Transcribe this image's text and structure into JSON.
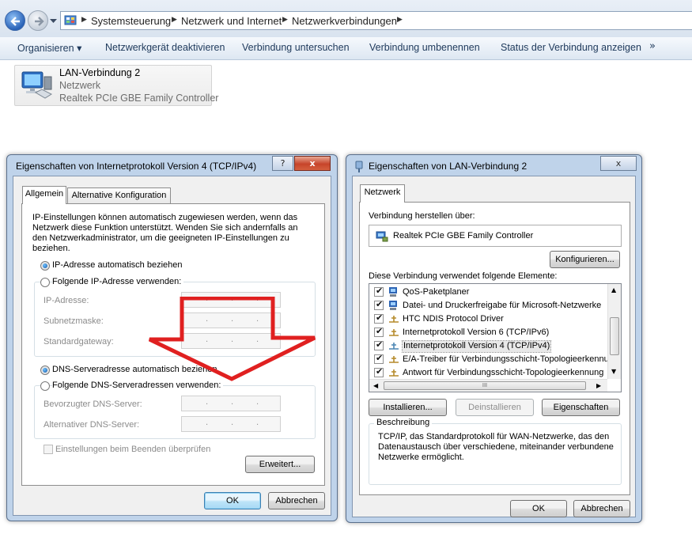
{
  "explorer": {
    "breadcrumb": [
      "Systemsteuerung",
      "Netzwerk und Internet",
      "Netzwerkverbindungen"
    ],
    "commands": {
      "organize": "Organisieren",
      "disable": "Netzwerkgerät deaktivieren",
      "diagnose": "Verbindung untersuchen",
      "rename": "Verbindung umbenennen",
      "status": "Status der Verbindung anzeigen",
      "more": "»"
    },
    "adapter": {
      "name": "LAN-Verbindung 2",
      "network": "Netzwerk",
      "device": "Realtek PCIe GBE Family Controller"
    }
  },
  "ipv4_dialog": {
    "title": "Eigenschaften von Internetprotokoll Version 4 (TCP/IPv4)",
    "help": "?",
    "close": "x",
    "tabs": [
      "Allgemein",
      "Alternative Konfiguration"
    ],
    "description_lines": [
      "IP-Einstellungen können automatisch zugewiesen werden, wenn das",
      "Netzwerk diese Funktion unterstützt. Wenden Sie sich andernfalls an",
      "den Netzwerkadministrator, um die geeigneten IP-Einstellungen zu",
      "beziehen."
    ],
    "ip_auto": "IP-Adresse automatisch beziehen",
    "ip_manual": "Folgende IP-Adresse verwenden:",
    "ip_address": "IP-Adresse:",
    "subnet": "Subnetzmaske:",
    "gateway": "Standardgateway:",
    "dns_auto": "DNS-Serveradresse automatisch beziehen",
    "dns_manual": "Folgende DNS-Serveradressen verwenden:",
    "dns_preferred": "Bevorzugter DNS-Server:",
    "dns_alternate": "Alternativer DNS-Server:",
    "validate": "Einstellungen beim Beenden überprüfen",
    "advanced": "Erweitert...",
    "ok": "OK",
    "cancel": "Abbrechen",
    "ip_auto_selected": true,
    "dns_auto_selected": true
  },
  "lan_dialog": {
    "title": "Eigenschaften von LAN-Verbindung 2",
    "close": "x",
    "tab": "Netzwerk",
    "connect_using": "Verbindung herstellen über:",
    "adapter": "Realtek PCIe GBE Family Controller",
    "configure": "Konfigurieren...",
    "items_label": "Diese Verbindung verwendet folgende Elemente:",
    "items": [
      {
        "label": "QoS-Paketplaner",
        "checked": true,
        "icon": "service-icon"
      },
      {
        "label": "Datei- und Druckerfreigabe für Microsoft-Netzwerke",
        "checked": true,
        "icon": "service-icon"
      },
      {
        "label": "HTC NDIS Protocol Driver",
        "checked": true,
        "icon": "protocol-icon"
      },
      {
        "label": "Internetprotokoll Version 6 (TCP/IPv6)",
        "checked": true,
        "icon": "protocol-icon"
      },
      {
        "label": "Internetprotokoll Version 4 (TCP/IPv4)",
        "checked": true,
        "icon": "protocol-icon",
        "selected": true
      },
      {
        "label": "E/A-Treiber für Verbindungsschicht-Topologieerkennung",
        "checked": true,
        "icon": "protocol-icon"
      },
      {
        "label": "Antwort für Verbindungsschicht-Topologieerkennung",
        "checked": true,
        "icon": "protocol-icon"
      }
    ],
    "install": "Installieren...",
    "uninstall": "Deinstallieren",
    "properties": "Eigenschaften",
    "description_title": "Beschreibung",
    "description_lines": [
      "TCP/IP, das Standardprotokoll für WAN-Netzwerke, das den",
      "Datenaustausch über verschiedene, miteinander verbundene",
      "Netzwerke ermöglicht."
    ],
    "ok": "OK",
    "cancel": "Abbrechen"
  },
  "colors": {
    "annotation_arrow": "#e02020",
    "selection_blue": "#3c7fb1"
  }
}
